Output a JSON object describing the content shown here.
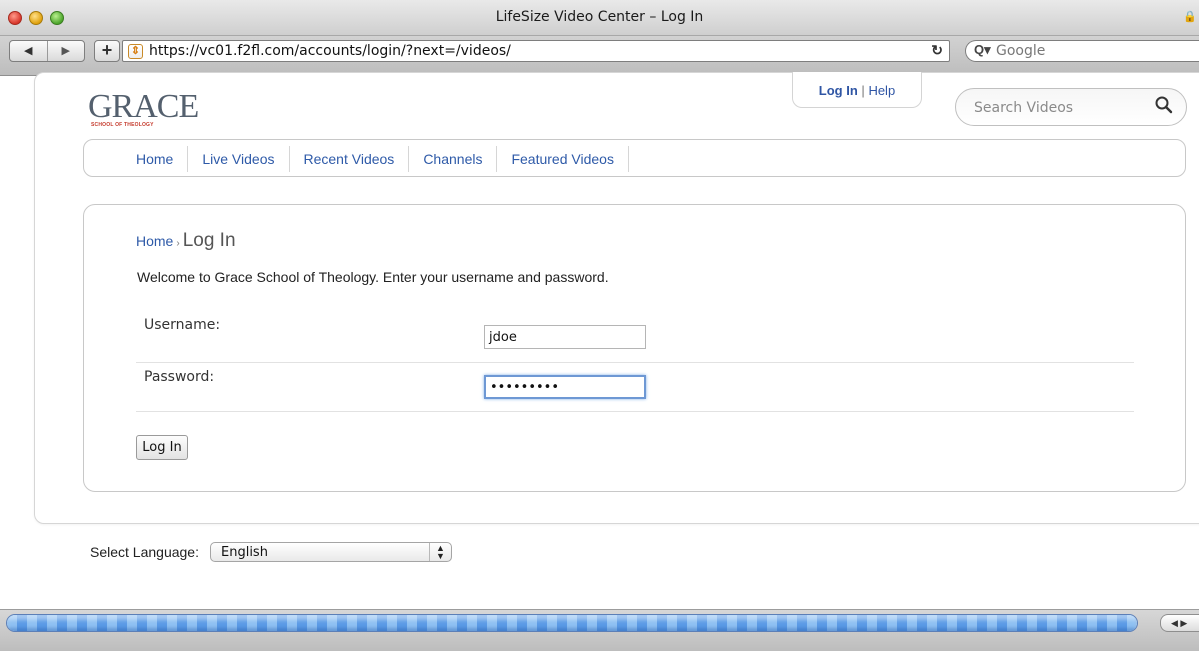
{
  "window": {
    "title": "LifeSize Video Center – Log In",
    "url": "https://vc01.f2fl.com/accounts/login/?next=/videos/",
    "search_engine_placeholder": "Google"
  },
  "site": {
    "logo_text": "GRACE",
    "logo_subtext": "SCHOOL OF THEOLOGY",
    "account_links": {
      "login": "Log In",
      "separator": "|",
      "help": "Help"
    },
    "search_placeholder": "Search Videos",
    "nav": [
      "Home",
      "Live Videos",
      "Recent Videos",
      "Channels",
      "Featured Videos"
    ]
  },
  "login": {
    "breadcrumb": {
      "home": "Home",
      "separator": "›",
      "current": "Log In"
    },
    "welcome": "Welcome to Grace School of Theology. Enter your username and password.",
    "username_label": "Username:",
    "username_value": "jdoe",
    "password_label": "Password:",
    "password_value": "•••••••••",
    "submit_label": "Log In"
  },
  "language": {
    "label": "Select Language:",
    "selected": "English"
  },
  "progress": {
    "fraction": 1.0
  },
  "colors": {
    "link": "#2e5aa8",
    "accent_focus": "#6e98d4",
    "progress": "#5b9be6"
  }
}
